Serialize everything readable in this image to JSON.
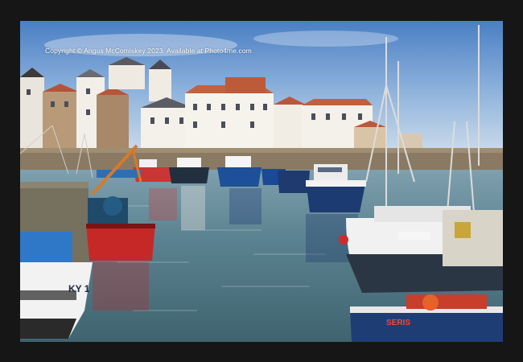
{
  "copyright": "Copyright © Angus McComiskey 2023. Available at Photo4me.com",
  "boat_registrations": {
    "left_boat": "KY 1",
    "right_boat": "SERIS"
  }
}
